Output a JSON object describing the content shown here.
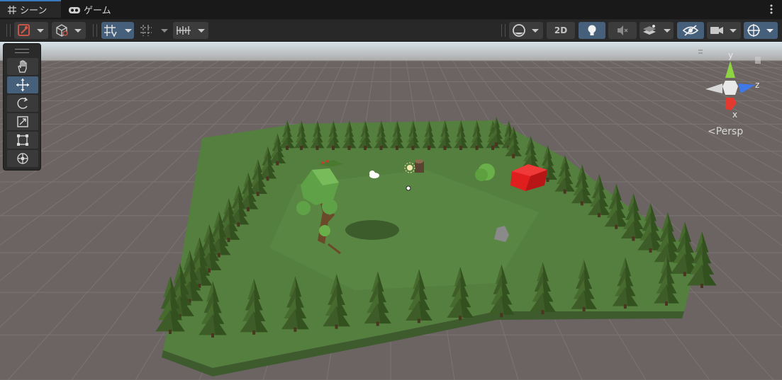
{
  "tabs": [
    {
      "label": "シーン",
      "icon": "grid-icon",
      "active": true
    },
    {
      "label": "ゲーム",
      "icon": "gamepad-icon",
      "active": false
    }
  ],
  "toolbar": {
    "left": [
      {
        "name": "draw-mode-button",
        "icon": "draw-mode-icon"
      },
      {
        "name": "render-mode-button",
        "icon": "cube-icon"
      },
      {
        "name": "grid-snap-button",
        "icon": "grid-snap-icon",
        "active": true
      },
      {
        "name": "increment-snap-button",
        "icon": "snap-icon"
      },
      {
        "name": "ruler-button",
        "icon": "ruler-icon"
      }
    ],
    "right": [
      {
        "name": "shading-mode-button",
        "icon": "sphere-icon"
      },
      {
        "name": "2d-toggle-button",
        "label": "2D"
      },
      {
        "name": "lighting-toggle-button",
        "icon": "lightbulb-icon",
        "active": true
      },
      {
        "name": "audio-toggle-button",
        "icon": "speaker-icon"
      },
      {
        "name": "effects-button",
        "icon": "layers-icon"
      },
      {
        "name": "visibility-toggle-button",
        "icon": "eye-slash-icon",
        "active": true
      },
      {
        "name": "camera-button",
        "icon": "camera-icon"
      },
      {
        "name": "gizmos-button",
        "icon": "globe-icon",
        "active": true
      }
    ]
  },
  "tools": [
    "hand-tool",
    "move-tool",
    "rotate-tool",
    "scale-tool",
    "rect-tool",
    "transform-tool"
  ],
  "active_tool": "move-tool",
  "gizmo": {
    "y_label": "y",
    "z_label": "z",
    "x_label": "x",
    "projection": "Persp"
  },
  "colors": {
    "accent": "#46607c",
    "tab_highlight": "#3a79bb",
    "grass": "#4e7a3a",
    "tree": "#3c5a26",
    "cube": "#e01e1e",
    "sky": "#bccdd4",
    "ground": "#6b6463"
  }
}
